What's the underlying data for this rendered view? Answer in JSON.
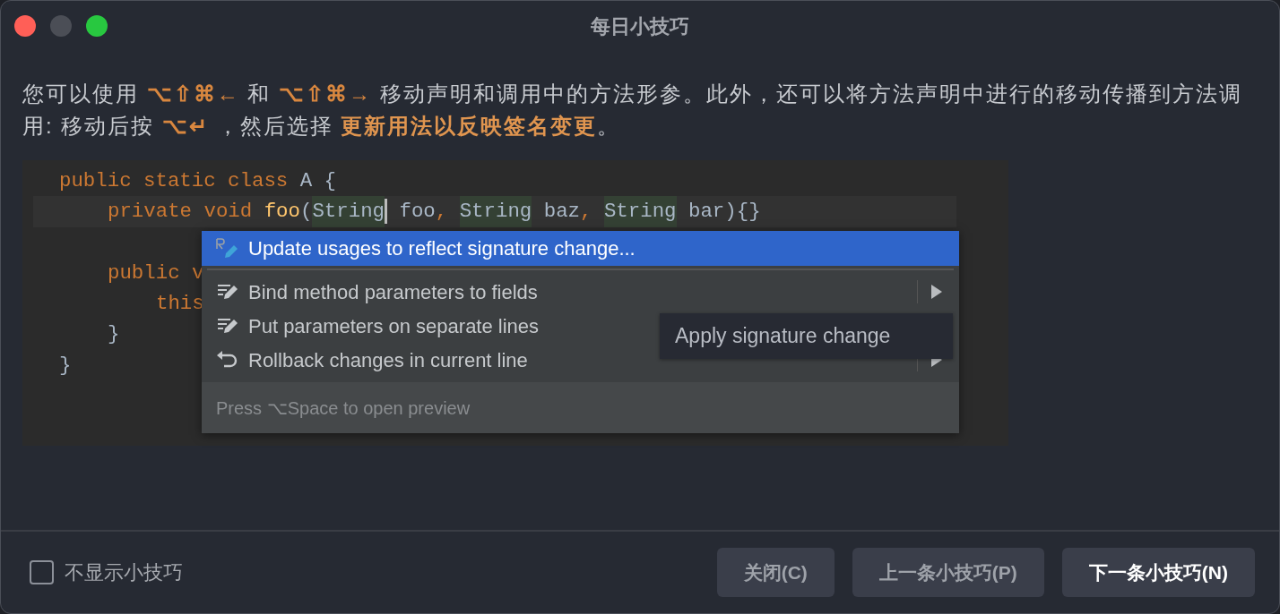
{
  "window": {
    "title": "每日小技巧"
  },
  "tip": [
    {
      "text": "您可以使用 ",
      "kind": "plain"
    },
    {
      "text": "⌥⇧⌘←",
      "kind": "shortcut"
    },
    {
      "text": " 和 ",
      "kind": "plain"
    },
    {
      "text": "⌥⇧⌘→",
      "kind": "shortcut"
    },
    {
      "text": " 移动声明和调用中的方法形参。此外，还可以将方法声明中进行的移动传播到方法调用: 移动后按 ",
      "kind": "plain"
    },
    {
      "text": "⌥↵",
      "kind": "shortcut"
    },
    {
      "text": " ，然后选择 ",
      "kind": "plain"
    },
    {
      "text": "更新用法以反映签名变更",
      "kind": "emphasis"
    },
    {
      "text": "。",
      "kind": "plain"
    }
  ],
  "code": {
    "lines": [
      {
        "current": false,
        "tokens": [
          {
            "t": "public static class ",
            "kind": "keyword"
          },
          {
            "t": "A {",
            "kind": "plain"
          }
        ],
        "children": [
          {
            "current": true,
            "tokens": [
              {
                "t": "private void ",
                "kind": "keyword"
              },
              {
                "t": "foo",
                "kind": "method"
              },
              {
                "t": "(",
                "kind": "plain"
              },
              {
                "t": "String",
                "kind": "highlight"
              },
              {
                "kind": "cursor"
              },
              {
                "t": " foo",
                "kind": "plain"
              },
              {
                "t": ", ",
                "kind": "keyword"
              },
              {
                "t": "String",
                "kind": "highlight"
              },
              {
                "t": " baz",
                "kind": "plain"
              },
              {
                "t": ", ",
                "kind": "keyword"
              },
              {
                "t": "String",
                "kind": "highlight"
              },
              {
                "t": " bar){}",
                "kind": "plain"
              }
            ]
          },
          {
            "current": false,
            "blank_before": true,
            "tokens": [
              {
                "t": "public v",
                "kind": "keyword"
              }
            ],
            "children": [
              {
                "current": false,
                "tokens": [
                  {
                    "t": "this",
                    "kind": "keyword"
                  }
                ]
              }
            ]
          },
          {
            "current": false,
            "tokens": [
              {
                "t": "}",
                "kind": "plain"
              }
            ]
          }
        ]
      },
      {
        "current": false,
        "tokens": [
          {
            "t": "}",
            "kind": "plain"
          }
        ]
      }
    ]
  },
  "popup": {
    "items": [
      {
        "label": "Update usages to reflect signature change...",
        "kind": "refactor",
        "selected": true,
        "submenu": false
      },
      {
        "label": "Bind method parameters to fields",
        "kind": "edit",
        "selected": false,
        "submenu": true
      },
      {
        "label": "Put parameters on separate lines",
        "kind": "edit",
        "selected": false
      },
      {
        "label": "Rollback changes in current line",
        "kind": "undo",
        "selected": false,
        "submenu": true
      }
    ],
    "hint": "Press ⌥Space to open preview"
  },
  "tooltip": "Apply signature change",
  "footer": {
    "checkbox": {
      "label": "不显示小技巧",
      "checked": false
    },
    "buttons": [
      {
        "label": "关闭(C)",
        "primary": false
      },
      {
        "label": "上一条小技巧(P)",
        "primary": false
      },
      {
        "label": "下一条小技巧(N)",
        "primary": true
      }
    ]
  }
}
